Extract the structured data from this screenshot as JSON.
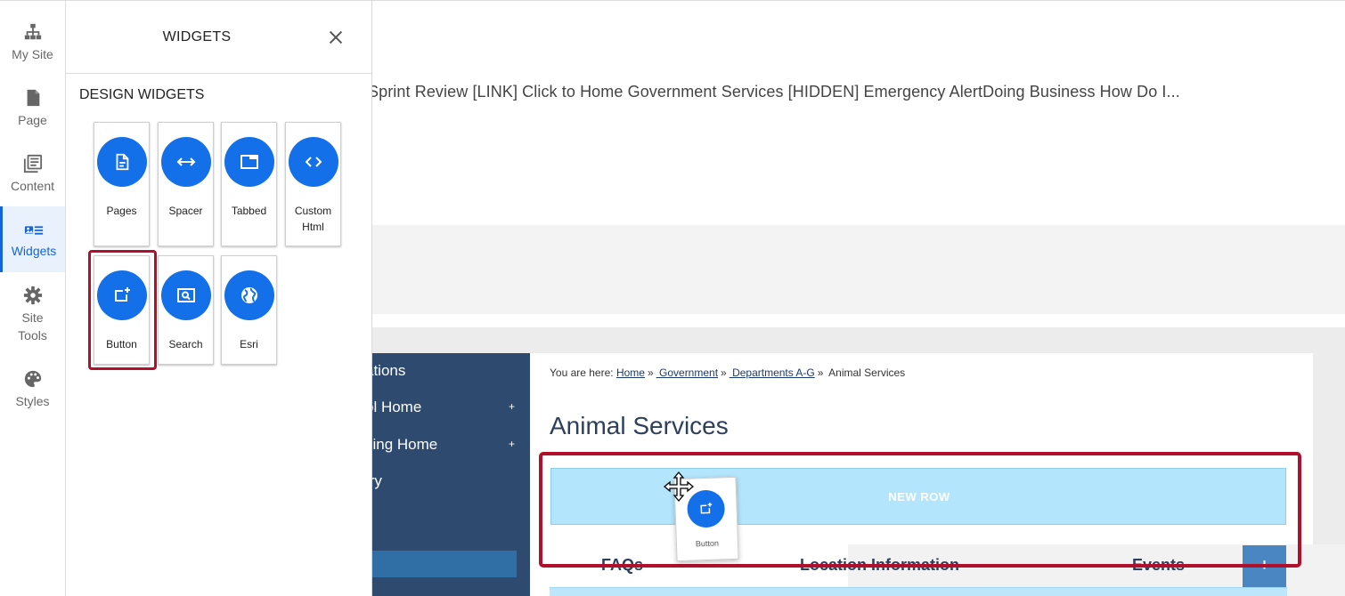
{
  "rail": {
    "items": [
      {
        "label": "My Site",
        "icon": "sitemap-icon"
      },
      {
        "label": "Page",
        "icon": "page-icon"
      },
      {
        "label": "Content",
        "icon": "content-icon"
      },
      {
        "label": "Widgets",
        "icon": "widgets-icon",
        "active": true
      },
      {
        "label": "Site\nTools",
        "label_line1": "Site",
        "label_line2": "Tools",
        "icon": "gear-icon"
      },
      {
        "label": "Styles",
        "icon": "palette-icon"
      }
    ],
    "accent_color": "#1565d8"
  },
  "panel": {
    "title": "WIDGETS",
    "section_title": "DESIGN WIDGETS",
    "widgets": [
      {
        "label": "Pages",
        "icon": "document-icon"
      },
      {
        "label": "Spacer",
        "icon": "horizontal-arrows-icon"
      },
      {
        "label": "Tabbed",
        "icon": "tab-window-icon"
      },
      {
        "label_line1": "Custom",
        "label_line2": "Html",
        "icon": "code-icon"
      },
      {
        "label": "Button",
        "icon": "add-button-icon"
      },
      {
        "label": "Search",
        "icon": "search-box-icon"
      },
      {
        "label": "Esri",
        "icon": "globe-icon"
      }
    ],
    "widget_circle_color": "#1470e8",
    "highlight_color": "#b0102c"
  },
  "main": {
    "menu_text": "Sprint Review  [LINK] Click to Home Government  Services  [HIDDEN] Emergency AlertDoing Business How Do I...",
    "nav": {
      "items": [
        {
          "label": "ations",
          "plus": ""
        },
        {
          "label": "ol Home",
          "plus": "+"
        },
        {
          "label": "sing Home",
          "plus": "+"
        },
        {
          "label": "try",
          "plus": ""
        }
      ]
    },
    "breadcrumb": {
      "prefix": "You are here:",
      "links": [
        "Home",
        " Government",
        " Departments A-G"
      ],
      "separator": "»",
      "current": "Animal Services"
    },
    "page_title": "Animal Services",
    "new_row_label": "NEW ROW",
    "drag_ghost_label": "Button",
    "tabs": [
      "FAQs",
      "Location Information",
      "Events"
    ],
    "tab_add_label": "+"
  }
}
